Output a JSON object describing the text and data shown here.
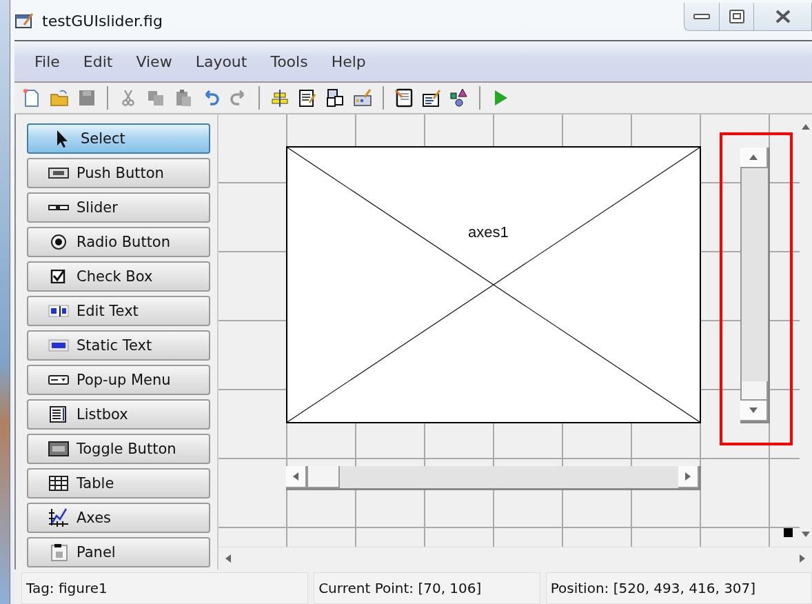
{
  "window": {
    "title": "testGUIslider.fig"
  },
  "menu": [
    "File",
    "Edit",
    "View",
    "Layout",
    "Tools",
    "Help"
  ],
  "palette": [
    {
      "label": "Select",
      "selected": true
    },
    {
      "label": "Push Button",
      "selected": false
    },
    {
      "label": "Slider",
      "selected": false
    },
    {
      "label": "Radio Button",
      "selected": false
    },
    {
      "label": "Check Box",
      "selected": false
    },
    {
      "label": "Edit Text",
      "selected": false
    },
    {
      "label": "Static Text",
      "selected": false
    },
    {
      "label": "Pop-up Menu",
      "selected": false
    },
    {
      "label": "Listbox",
      "selected": false
    },
    {
      "label": "Toggle Button",
      "selected": false
    },
    {
      "label": "Table",
      "selected": false
    },
    {
      "label": "Axes",
      "selected": false
    },
    {
      "label": "Panel",
      "selected": false
    }
  ],
  "canvas": {
    "axes": {
      "label": "axes1"
    },
    "sliders": [
      {
        "kind": "horizontal",
        "level": 0,
        "highlighted": false
      },
      {
        "kind": "vertical",
        "level": 0,
        "highlighted": true
      }
    ]
  },
  "status_bar": [
    "Tag: figure1",
    "Current Point:  [70, 106]",
    "Position: [520, 493, 416, 307]"
  ]
}
